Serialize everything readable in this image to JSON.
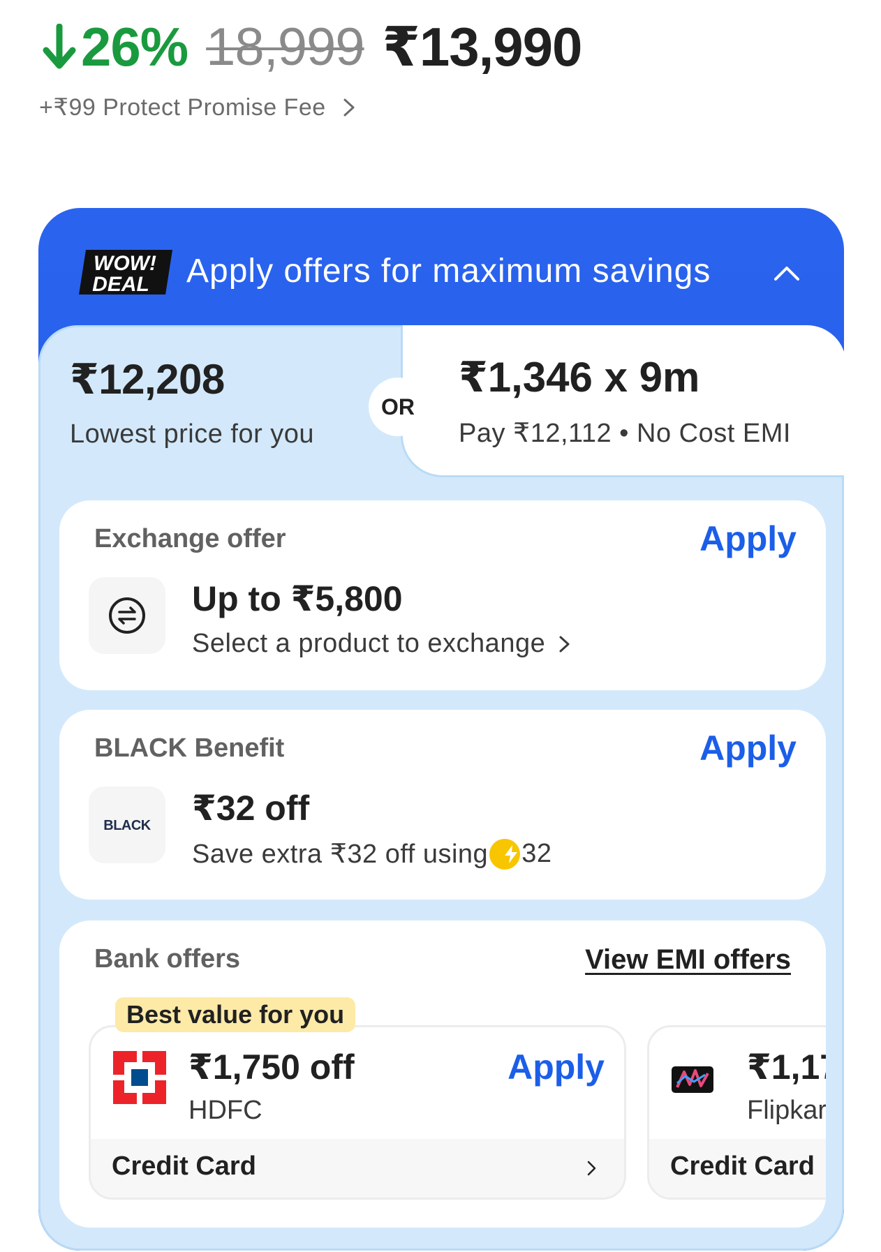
{
  "price": {
    "discount": "26%",
    "mrp": "18,999",
    "sale_price": "₹13,990",
    "fee_text": "+₹99 Protect Promise Fee",
    "discount_color": "#1a9a3e"
  },
  "offers_panel": {
    "deal_badge_line1": "WOW!",
    "deal_badge_line2": "DEAL",
    "header_text": "Apply offers for maximum savings",
    "lowest_price": "₹12,208",
    "lowest_label": "Lowest price for you",
    "or_label": "OR",
    "emi_price": "₹1,346 x 9m",
    "emi_label": "Pay ₹12,112 • No Cost EMI",
    "accent_color": "#2a64ee"
  },
  "exchange_offer": {
    "title": "Exchange offer",
    "apply_label": "Apply",
    "amount": "Up to ₹5,800",
    "subtitle": "Select a product to exchange",
    "icon": "exchange-arrows-icon"
  },
  "black_benefit": {
    "title": "BLACK Benefit",
    "apply_label": "Apply",
    "logo_text": "BLACK",
    "amount": "₹32 off",
    "subtitle_prefix": "Save extra ₹32 off using",
    "coin_value": "32",
    "icon": "supercoin-icon"
  },
  "bank_offers": {
    "title": "Bank offers",
    "view_emi_label": "View EMI offers",
    "best_value_badge": "Best value for you",
    "offers": [
      {
        "amount": "₹1,750 off",
        "bank": "HDFC",
        "apply_label": "Apply",
        "card_type": "Credit Card",
        "logo": "hdfc-logo-icon"
      },
      {
        "amount": "₹1,17",
        "bank": "Flipkar",
        "card_type": "Credit Card",
        "logo": "flipkart-card-icon"
      }
    ]
  }
}
